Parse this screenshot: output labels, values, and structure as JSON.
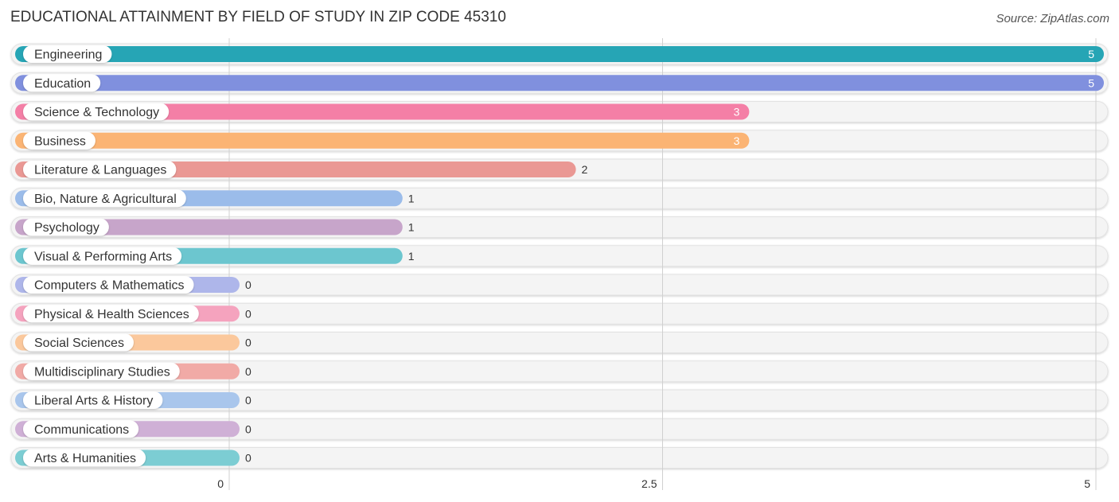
{
  "header": {
    "title": "EDUCATIONAL ATTAINMENT BY FIELD OF STUDY IN ZIP CODE 45310",
    "source": "Source: ZipAtlas.com"
  },
  "chart_data": {
    "type": "bar",
    "orientation": "horizontal",
    "title": "EDUCATIONAL ATTAINMENT BY FIELD OF STUDY IN ZIP CODE 45310",
    "xlabel": "",
    "ylabel": "",
    "xlim": [
      0,
      5
    ],
    "x_ticks": [
      0,
      2.5,
      5
    ],
    "x_tick_labels": [
      "0",
      "2.5",
      "5"
    ],
    "grid": true,
    "legend": "none",
    "categories": [
      "Engineering",
      "Education",
      "Science & Technology",
      "Business",
      "Literature & Languages",
      "Bio, Nature & Agricultural",
      "Psychology",
      "Visual & Performing Arts",
      "Computers & Mathematics",
      "Physical & Health Sciences",
      "Social Sciences",
      "Multidisciplinary Studies",
      "Liberal Arts & History",
      "Communications",
      "Arts & Humanities"
    ],
    "values": [
      5,
      5,
      3,
      3,
      2,
      1,
      1,
      1,
      0,
      0,
      0,
      0,
      0,
      0,
      0
    ],
    "value_labels": [
      "5",
      "5",
      "3",
      "3",
      "2",
      "1",
      "1",
      "1",
      "0",
      "0",
      "0",
      "0",
      "0",
      "0",
      "0"
    ],
    "colors": [
      "#26a5b5",
      "#8090de",
      "#f47fa6",
      "#fbb474",
      "#ea9894",
      "#9bbcea",
      "#c7a5ca",
      "#6cc6cf",
      "#aeb6ea",
      "#f5a3be",
      "#fbc89c",
      "#f1aaa6",
      "#a9c6ec",
      "#cfb0d6",
      "#7ccdd3"
    ]
  }
}
